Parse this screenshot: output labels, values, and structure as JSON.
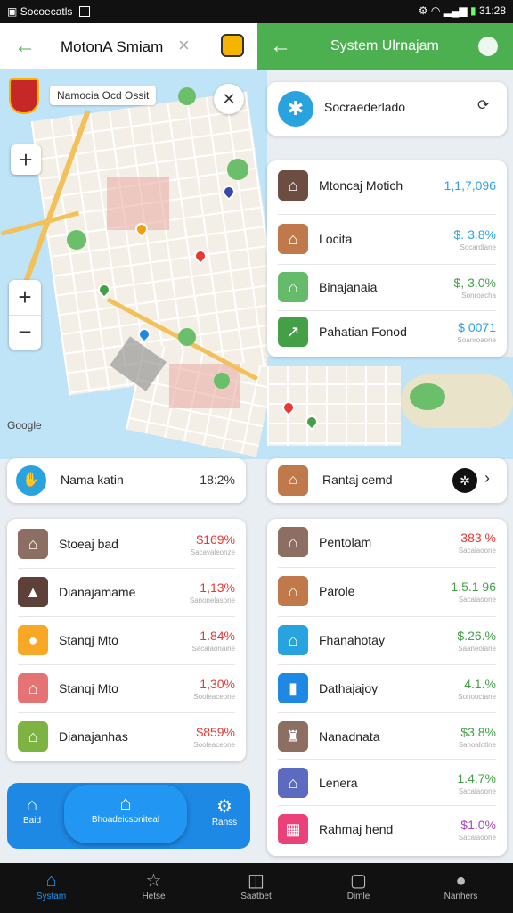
{
  "status": {
    "left_text": "Socoecatls",
    "time": "31:28"
  },
  "left_header": {
    "title": "MotonA Smiam"
  },
  "right_header": {
    "title": "System Ulrnajam"
  },
  "map": {
    "search_label": "Namocia Ocd Ossit",
    "watermark": "Google",
    "zoom_in": "+",
    "zoom_out": "−"
  },
  "right_top": {
    "label": "Socraederlado"
  },
  "right_list": [
    {
      "name": "Mtoncaj Motich",
      "value": "1,1,7,096",
      "color": "#29a3e0",
      "icon": "house-icon"
    },
    {
      "name": "Locita",
      "value": "$. 3.8%",
      "color": "#29a3e0",
      "sub": "Socardlane",
      "icon": "house-icon"
    },
    {
      "name": "Binajanaia",
      "value": "$, 3.0%",
      "color": "#43a047",
      "sub": "Sonroacha",
      "icon": "house-icon"
    },
    {
      "name": "Pahatian Fonod",
      "value": "$ 0071",
      "color": "#29a3e0",
      "sub": "Soanroaone",
      "icon": "chart-icon"
    }
  ],
  "left_summary": {
    "name": "Nama katin",
    "value": "18:2%"
  },
  "right_summary": {
    "name": "Rantaj cemd"
  },
  "left_list": [
    {
      "name": "Stoeaj bad",
      "value": "$169%",
      "color": "#e53935",
      "sub": "Sacavaleonze"
    },
    {
      "name": "Dianajamame",
      "value": "1,13%",
      "color": "#e53935",
      "sub": "Sanonelasone"
    },
    {
      "name": "Stanqj Mto",
      "value": "1.84%",
      "color": "#e53935",
      "sub": "Sacalaonaine"
    },
    {
      "name": "Stanqj Mto",
      "value": "1,30%",
      "color": "#e53935",
      "sub": "Sooleaceone"
    },
    {
      "name": "Dianajanhas",
      "value": "$859%",
      "color": "#e53935",
      "sub": "Sooleaceone"
    }
  ],
  "right_list2": [
    {
      "name": "Pentolam",
      "value": "383 %",
      "color": "#e53935",
      "sub": "Sacalaoone"
    },
    {
      "name": "Parole",
      "value": "1.5.1 96",
      "color": "#43a047",
      "sub": "Sacalaoone"
    },
    {
      "name": "Fhanahotay",
      "value": "$.26.%",
      "color": "#43a047",
      "sub": "Saaneolane"
    },
    {
      "name": "Dathajajoy",
      "value": "4.1.%",
      "color": "#43a047",
      "sub": "Sonooctane"
    },
    {
      "name": "Nanadnata",
      "value": "$3.8%",
      "color": "#43a047",
      "sub": "Sanoalotlne"
    },
    {
      "name": "Lenera",
      "value": "1.4.7%",
      "color": "#43a047",
      "sub": "Sacalaoone"
    },
    {
      "name": "Rahmaj hend",
      "value": "$1.0%",
      "color": "#ab47bc",
      "sub": "Sacalaoone"
    }
  ],
  "actions": {
    "left": "Baid",
    "center": "Bhoadeicsoniteal",
    "right": "Ranss"
  },
  "nav": [
    {
      "label": "Systam"
    },
    {
      "label": "Hetse"
    },
    {
      "label": "Saatbet"
    },
    {
      "label": "Dimle"
    },
    {
      "label": "Nanhers"
    }
  ]
}
